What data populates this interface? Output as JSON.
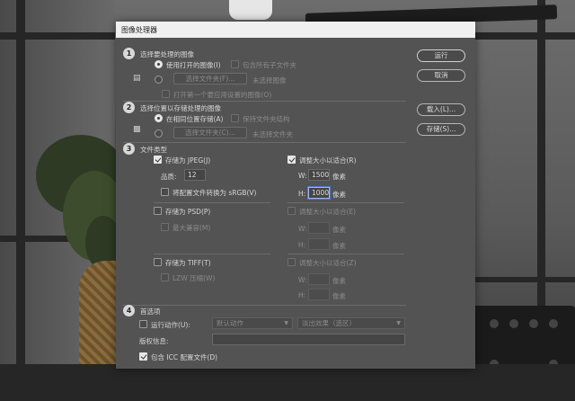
{
  "dialog": {
    "title": "图像处理器",
    "buttons": {
      "run": "运行",
      "cancel": "取消",
      "load": "载入(L)...",
      "save": "存储(S)..."
    }
  },
  "section1": {
    "num": "1",
    "title": "选择要处理的图像",
    "use_open": "使用打开的图像(I)",
    "include_sub": "包含所有子文件夹",
    "select_folder": "选择文件夹(F)...",
    "no_image": "未选择图像",
    "open_first": "打开第一个要应用设置的图像(O)"
  },
  "section2": {
    "num": "2",
    "title": "选择位置以存储处理的图像",
    "same_location": "在相同位置存储(A)",
    "keep_structure": "保持文件夹结构",
    "select_folder": "选择文件夹(C)...",
    "no_folder": "未选择文件夹"
  },
  "section3": {
    "num": "3",
    "title": "文件类型",
    "jpeg": {
      "save_as": "存储为 JPEG(J)",
      "resize": "调整大小以适合(R)",
      "quality_label": "品质:",
      "quality": "12",
      "convert": "将配置文件转换为 sRGB(V)",
      "w_label": "W:",
      "w": "1500",
      "w_unit": "像素",
      "h_label": "H:",
      "h": "1000",
      "h_unit": "像素"
    },
    "psd": {
      "save_as": "存储为 PSD(P)",
      "resize": "调整大小以适合(E)",
      "max_compat": "最大兼容(M)",
      "w_label": "W:",
      "w_unit": "像素",
      "h_label": "H:",
      "h_unit": "像素"
    },
    "tiff": {
      "save_as": "存储为 TIFF(T)",
      "resize": "调整大小以适合(Z)",
      "lzw": "LZW 压缩(W)",
      "w_label": "W:",
      "w_unit": "像素",
      "h_label": "H:",
      "h_unit": "像素"
    }
  },
  "section4": {
    "num": "4",
    "title": "首选项",
    "run_action": "运行动作(U):",
    "action_set": "默认动作",
    "action": "淡出效果（选区）",
    "copyright": "版权信息:",
    "include_icc": "包含 ICC 配置文件(D)"
  },
  "colors": {
    "panel": "#535353",
    "titlebar": "#f0f0f0",
    "focus": "#4b7bd8"
  }
}
